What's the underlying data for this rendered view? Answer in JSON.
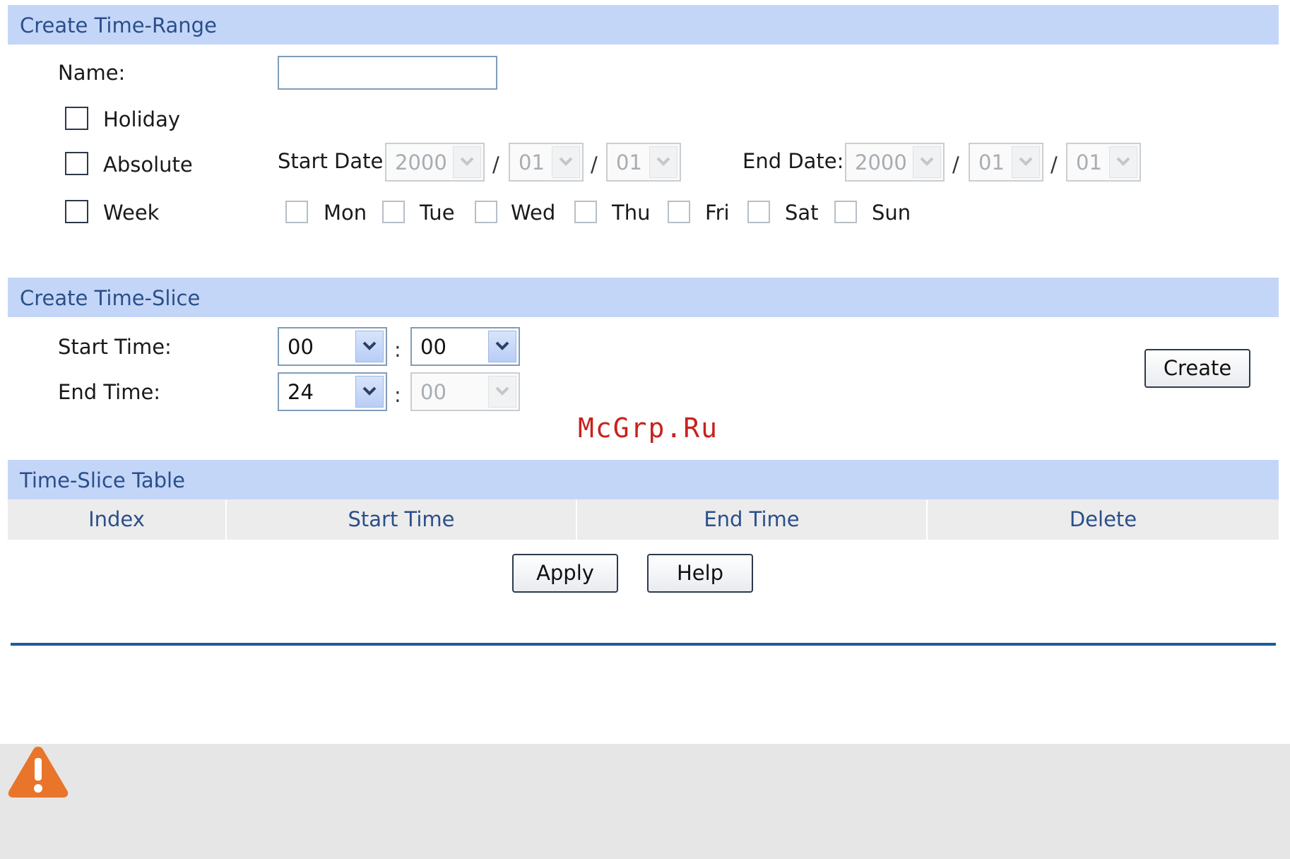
{
  "time_range": {
    "title": "Create Time-Range",
    "name_label": "Name:",
    "name_value": "",
    "holiday_label": "Holiday",
    "absolute_label": "Absolute",
    "week_label": "Week",
    "start_date_label": "Start Date:",
    "end_date_label": "End Date:",
    "date_sep": "/",
    "start_date": {
      "year": "2000",
      "month": "01",
      "day": "01"
    },
    "end_date": {
      "year": "2000",
      "month": "01",
      "day": "01"
    },
    "days": [
      "Mon",
      "Tue",
      "Wed",
      "Thu",
      "Fri",
      "Sat",
      "Sun"
    ]
  },
  "time_slice": {
    "title": "Create Time-Slice",
    "start_time_label": "Start Time:",
    "end_time_label": "End Time:",
    "time_sep": ":",
    "start_hour": "00",
    "start_min": "00",
    "end_hour": "24",
    "end_min": "00",
    "create_label": "Create"
  },
  "watermark": "McGrp.Ru",
  "table": {
    "title": "Time-Slice Table",
    "columns": [
      "Index",
      "Start Time",
      "End Time",
      "Delete"
    ]
  },
  "buttons": {
    "apply": "Apply",
    "help": "Help"
  },
  "colors": {
    "section_header": "#c4d6f8",
    "header_text": "#2a4f8a",
    "divider": "#1f5a96",
    "warning": "#e8752a"
  },
  "icons": {
    "warning": "warning-icon"
  }
}
